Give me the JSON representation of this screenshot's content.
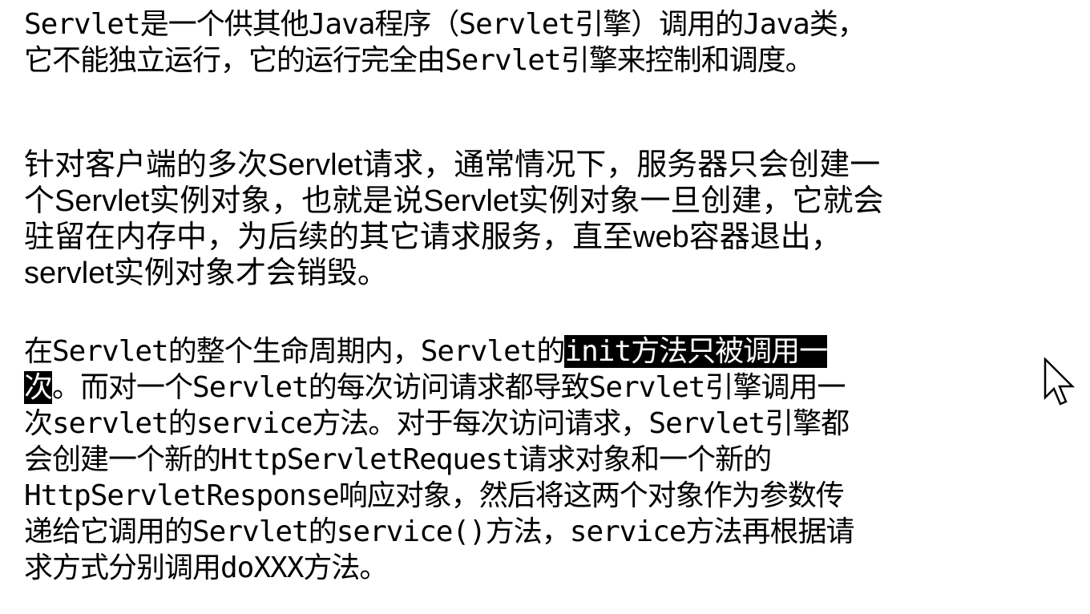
{
  "paragraph1": {
    "lines": [
      "Servlet是一个供其他Java程序（Servlet引擎）调用的Java类，",
      "它不能独立运行，它的运行完全由Servlet引擎来控制和调度。"
    ]
  },
  "paragraph2": {
    "lines": [
      "针对客户端的多次Servlet请求，通常情况下，服务器只会创建一",
      "个Servlet实例对象，也就是说Servlet实例对象一旦创建，它就会",
      "驻留在内存中，为后续的其它请求服务，直至web容器退出，",
      "servlet实例对象才会销毁。"
    ]
  },
  "paragraph3": {
    "line1_before": "在Servlet的整个生命周期内，Servlet的",
    "line1_selected": "init方法只被调用一",
    "line2_selected": "次",
    "line2_after": "。而对一个Servlet的每次访问请求都导致Servlet引擎调用一",
    "lines_rest": [
      "次servlet的service方法。对于每次访问请求，Servlet引擎都",
      "会创建一个新的HttpServletRequest请求对象和一个新的",
      "HttpServletResponse响应对象，然后将这两个对象作为参数传",
      "递给它调用的Servlet的service()方法，service方法再根据请",
      "求方式分别调用doXXX方法。"
    ]
  },
  "colors": {
    "text": "#000000",
    "background": "#ffffff",
    "selection_background": "#000000",
    "selection_text": "#ffffff"
  },
  "icons": {
    "cursor": "mouse-pointer-icon"
  }
}
